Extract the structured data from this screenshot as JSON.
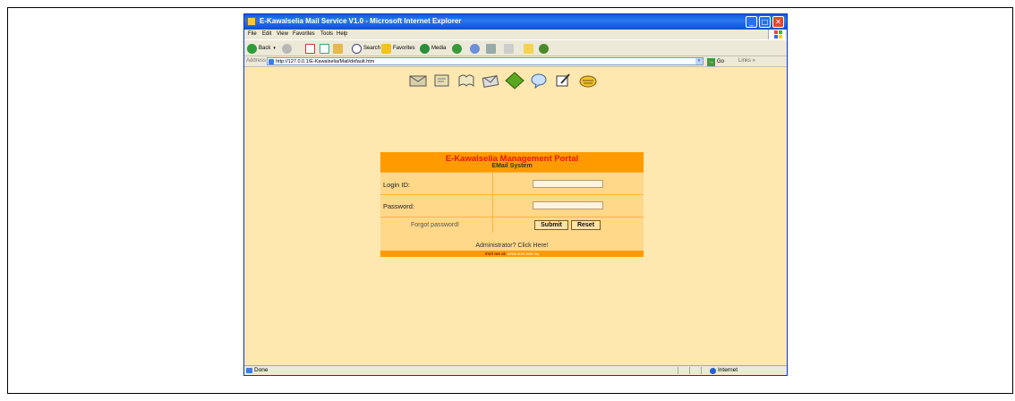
{
  "window": {
    "title": "E-Kawalselia Mail Service V1.0 - Microsoft Internet Explorer",
    "controls": {
      "minimize": "_",
      "maximize": "□",
      "close": "✕"
    }
  },
  "menu": [
    "File",
    "Edit",
    "View",
    "Favorites",
    "Tools",
    "Help"
  ],
  "toolbar": {
    "back": "Back",
    "search": "Search",
    "favorites": "Favorites",
    "media": "Media"
  },
  "address": {
    "label": "Address",
    "url": "http://127.0.0.1/E-Kawalselia/Mail/default.htm",
    "go": "Go",
    "links": "Links"
  },
  "nav_icons": [
    "mail-inbox-icon",
    "compose-icon",
    "address-book-icon",
    "envelope-icon",
    "diamond-icon",
    "speech-bubble-icon",
    "edit-icon",
    "logout-icon"
  ],
  "portal": {
    "title": "E-Kawalselia Management Portal",
    "subtitle": "EMail System",
    "login_label": "Login ID:",
    "password_label": "Password:",
    "forgot": "Forgot password!",
    "submit": "Submit",
    "reset": "Reset",
    "admin": "Administrator? Click Here!",
    "visit_label": "Visit me at:",
    "visit_url": "www.uum.edu.my"
  },
  "status": {
    "text": "Done",
    "zone": "Internet"
  },
  "colors": {
    "portal_header": "#ff9a00",
    "portal_title": "#e8150c",
    "content_bg": "#ffe8b0",
    "xp_blue": "#0a5ddc"
  }
}
